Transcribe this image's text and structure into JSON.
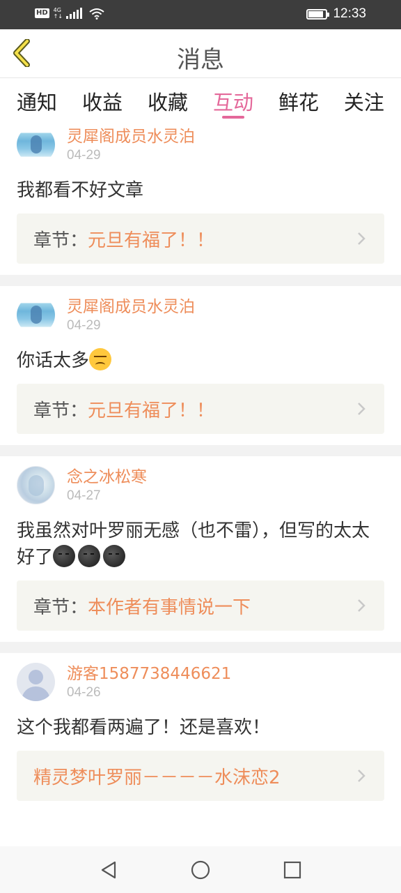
{
  "status_bar": {
    "hd": "HD",
    "network_top": "4G",
    "network_bottom": "↑↓",
    "time": "12:33",
    "battery_level": 0.85
  },
  "header": {
    "title": "消息",
    "back_icon": "chevron-left-icon",
    "accent_color": "#e4689a"
  },
  "tabs": [
    {
      "label": "通知"
    },
    {
      "label": "收益"
    },
    {
      "label": "收藏"
    },
    {
      "label": "互动",
      "active": true
    },
    {
      "label": "鲜花"
    },
    {
      "label": "关注"
    }
  ],
  "feed": {
    "items": [
      {
        "username": "灵犀阁成员水灵泊",
        "date": "04-29",
        "comment": "我都看不好文章",
        "chapter_prefix": "章节：",
        "chapter_title": "元旦有福了！！"
      },
      {
        "username": "灵犀阁成员水灵泊",
        "date": "04-29",
        "comment": "你话太多",
        "emoji": "disappointed-face",
        "chapter_prefix": "章节：",
        "chapter_title": "元旦有福了！！"
      },
      {
        "username": "念之冰松寒",
        "date": "04-27",
        "comment": "我虽然对叶罗丽无感（也不雷），但写的太太好了",
        "emoji": "new-moon-face",
        "chapter_prefix": "章节：",
        "chapter_title": "本作者有事情说一下"
      },
      {
        "username": "游客1587738446621",
        "date": "04-26",
        "comment": "这个我都看两遍了！还是喜欢！",
        "chapter_prefix": "",
        "chapter_title": "精灵梦叶罗丽－－－－水沫恋2"
      }
    ]
  },
  "nav_bar": {
    "back": "triangle-back-icon",
    "home": "circle-home-icon",
    "recents": "square-recents-icon"
  }
}
